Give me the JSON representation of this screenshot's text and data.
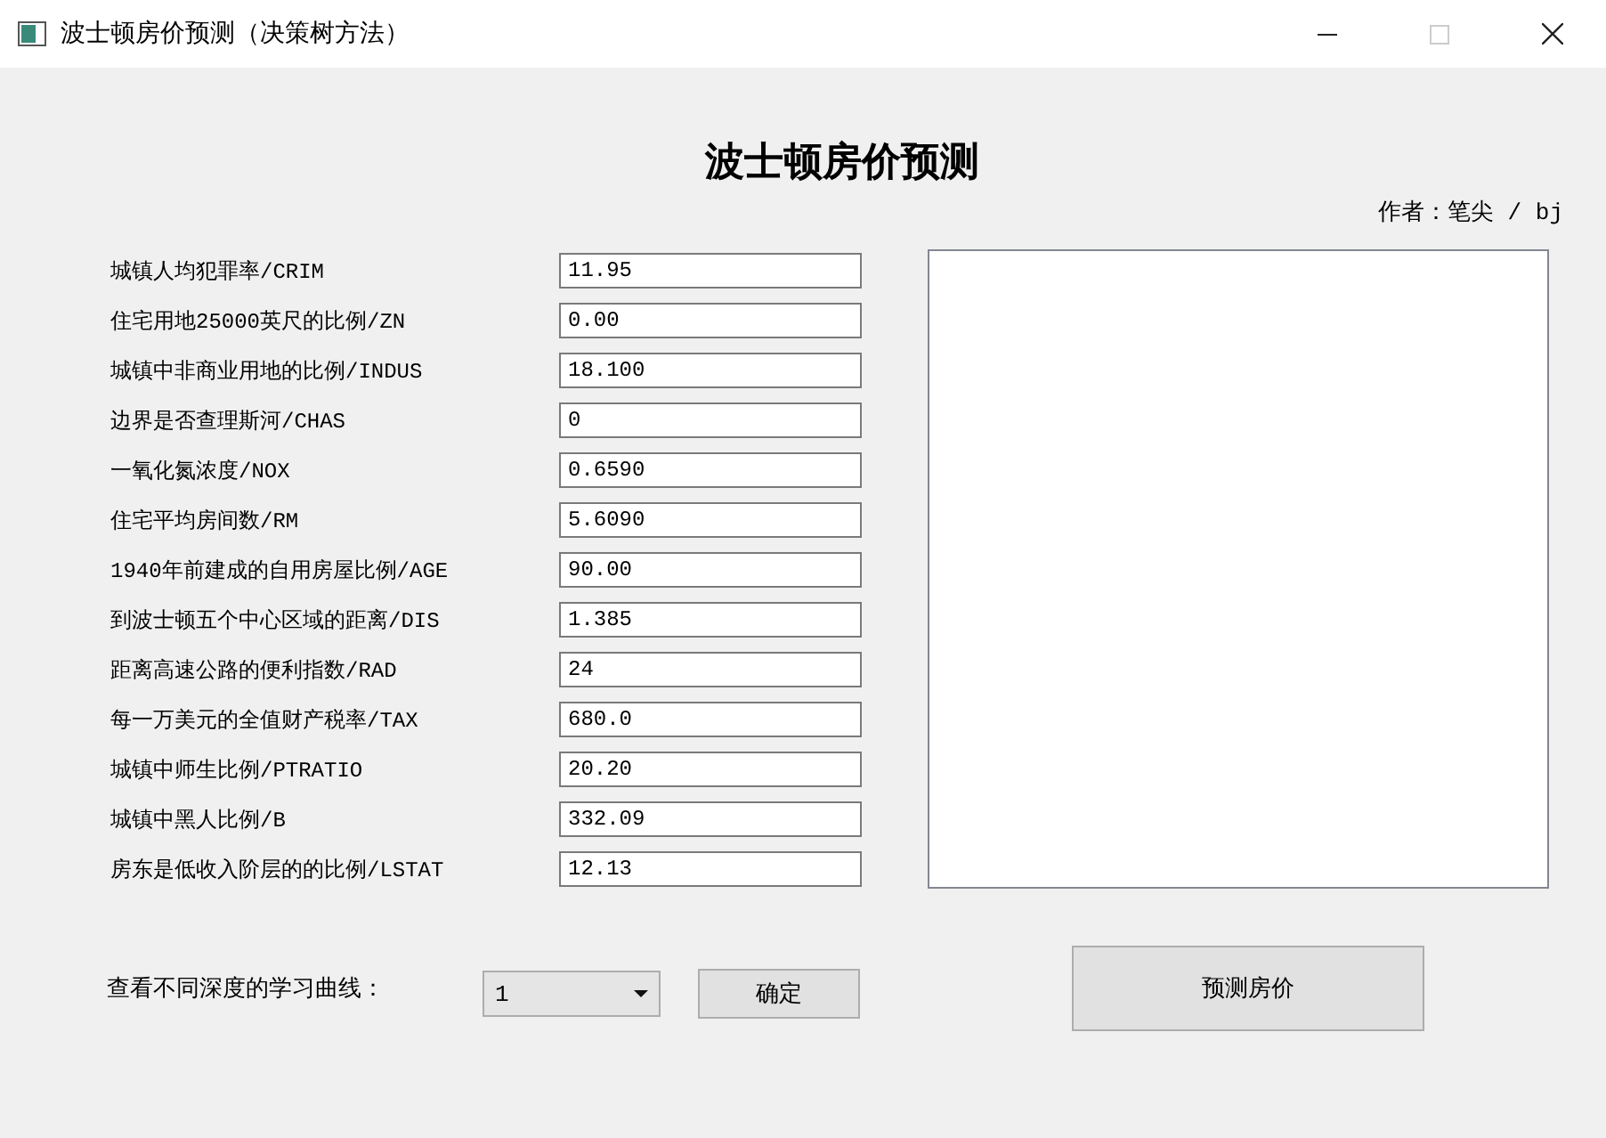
{
  "window": {
    "title": "波士顿房价预测（决策树方法）"
  },
  "heading": "波士顿房价预测",
  "author": "作者：笔尖 / bj",
  "fields": [
    {
      "label": "城镇人均犯罪率/CRIM",
      "value": "11.95"
    },
    {
      "label": "住宅用地25000英尺的比例/ZN",
      "value": "0.00"
    },
    {
      "label": "城镇中非商业用地的比例/INDUS",
      "value": "18.100"
    },
    {
      "label": "边界是否查理斯河/CHAS",
      "value": "0"
    },
    {
      "label": "一氧化氮浓度/NOX",
      "value": "0.6590"
    },
    {
      "label": "住宅平均房间数/RM",
      "value": "5.6090"
    },
    {
      "label": "1940年前建成的自用房屋比例/AGE",
      "value": "90.00"
    },
    {
      "label": "到波士顿五个中心区域的距离/DIS",
      "value": "1.385"
    },
    {
      "label": "距离高速公路的便利指数/RAD",
      "value": "24"
    },
    {
      "label": "每一万美元的全值财产税率/TAX",
      "value": "680.0"
    },
    {
      "label": "城镇中师生比例/PTRATIO",
      "value": "20.20"
    },
    {
      "label": "城镇中黑人比例/B",
      "value": "332.09"
    },
    {
      "label": "房东是低收入阶层的的比例/LSTAT",
      "value": "12.13"
    }
  ],
  "curve": {
    "label": "查看不同深度的学习曲线：",
    "depth": "1",
    "confirm_button": "确定"
  },
  "predict_button": "预测房价"
}
